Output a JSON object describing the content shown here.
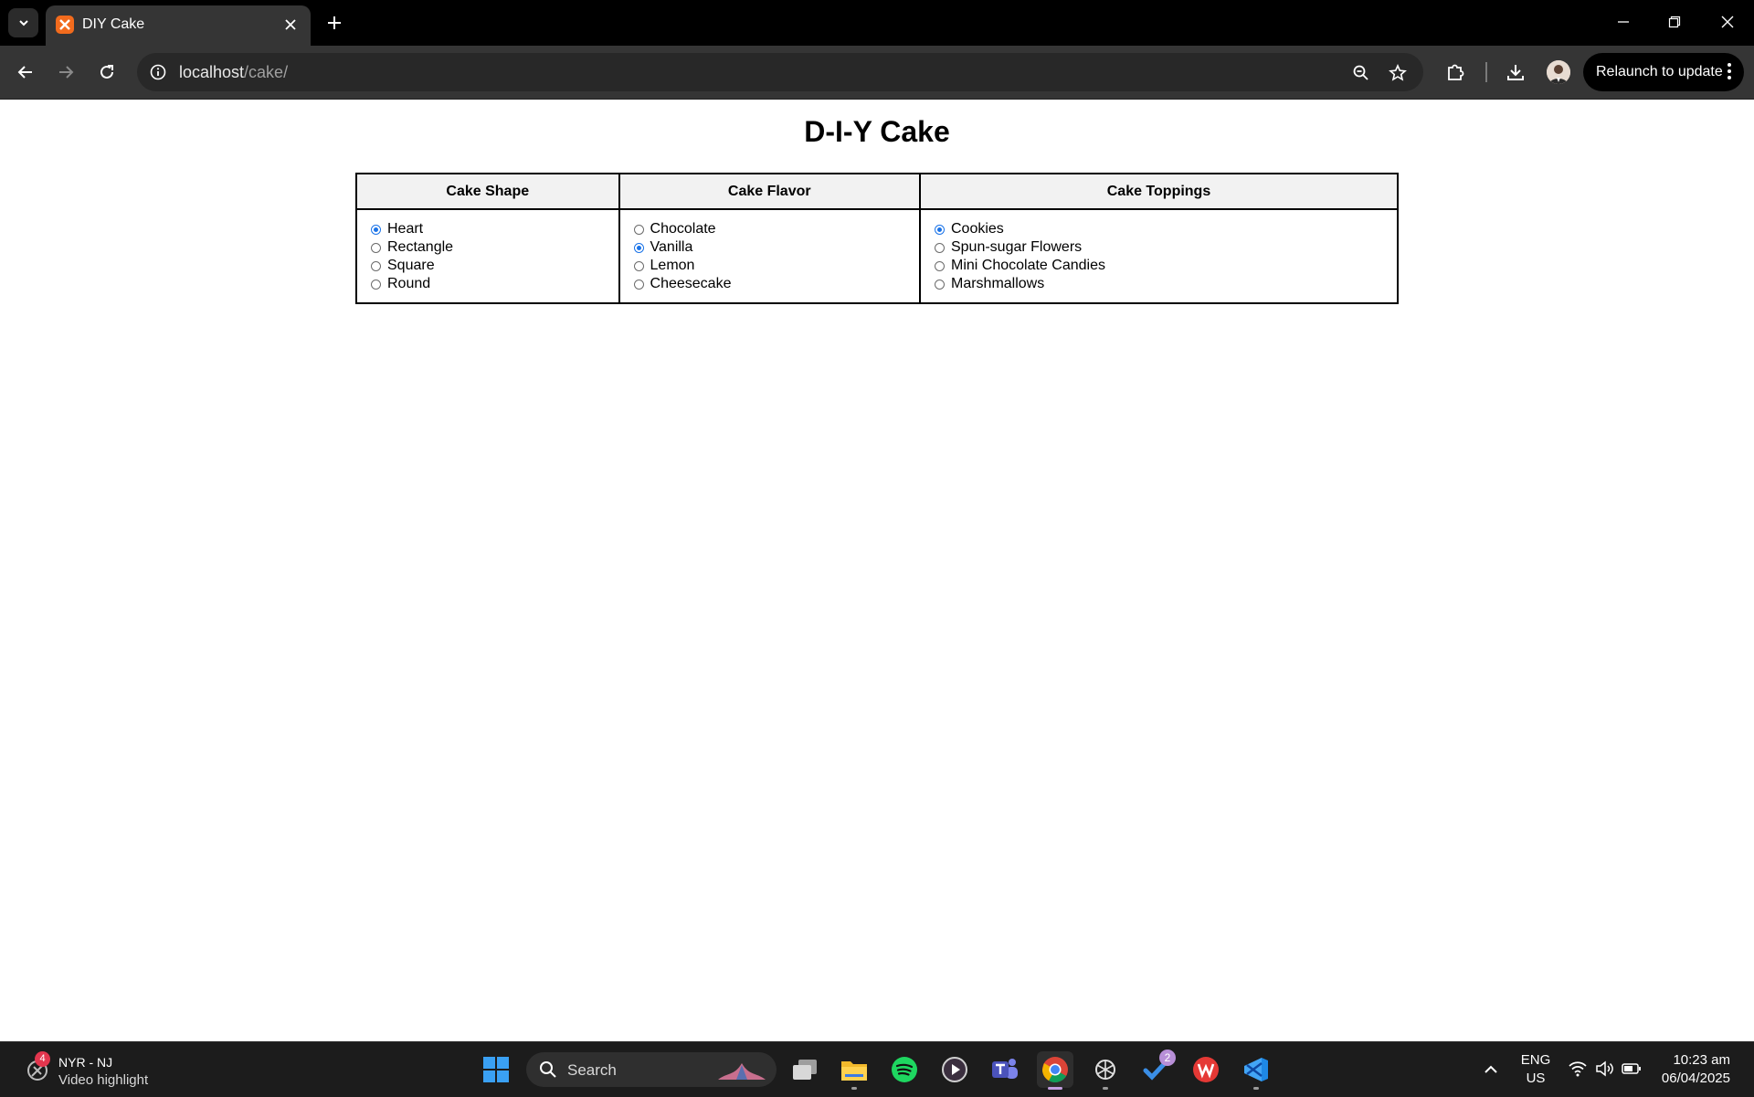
{
  "browser": {
    "tab_title": "DIY Cake",
    "url_host": "localhost",
    "url_path": "/cake/",
    "relaunch_label": "Relaunch to update"
  },
  "page": {
    "title": "D-I-Y Cake",
    "columns": [
      {
        "header": "Cake Shape",
        "options": [
          {
            "label": "Heart",
            "checked": true
          },
          {
            "label": "Rectangle",
            "checked": false
          },
          {
            "label": "Square",
            "checked": false
          },
          {
            "label": "Round",
            "checked": false
          }
        ]
      },
      {
        "header": "Cake Flavor",
        "options": [
          {
            "label": "Chocolate",
            "checked": false
          },
          {
            "label": "Vanilla",
            "checked": true
          },
          {
            "label": "Lemon",
            "checked": false
          },
          {
            "label": "Cheesecake",
            "checked": false
          }
        ]
      },
      {
        "header": "Cake Toppings",
        "options": [
          {
            "label": "Cookies",
            "checked": true
          },
          {
            "label": "Spun-sugar Flowers",
            "checked": false
          },
          {
            "label": "Mini Chocolate Candies",
            "checked": false
          },
          {
            "label": "Marshmallows",
            "checked": false
          }
        ]
      }
    ]
  },
  "taskbar": {
    "widget_badge": "4",
    "widget_title": "NYR - NJ",
    "widget_subtitle": "Video highlight",
    "search_label": "Search",
    "todo_badge": "2",
    "language": "ENG",
    "region": "US",
    "time": "10:23 am",
    "date": "06/04/2025"
  },
  "colors": {
    "accent": "#1a73e8",
    "tab_favicon": "#f26b1d",
    "chrome_dark": "#353535"
  }
}
